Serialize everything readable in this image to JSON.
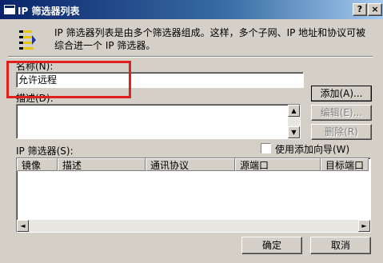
{
  "window": {
    "title": "IP 筛选器列表",
    "help_glyph": "?",
    "close_glyph": "×"
  },
  "intro": {
    "text": "IP 筛选器列表是由多个筛选器组成。这样，多个子网、IP 地址和协议可被综合进一个 IP 筛选器。"
  },
  "name": {
    "label": "名称(N):",
    "value": "允许远程"
  },
  "description": {
    "label": "描述(D):",
    "value": ""
  },
  "buttons": {
    "add": "添加(A)...",
    "edit": "编辑(E)...",
    "remove": "删除(R)",
    "ok": "确定",
    "cancel": "取消"
  },
  "wizard_checkbox": {
    "label": "使用添加向导(W)",
    "checked": false
  },
  "filters": {
    "label": "IP 筛选器(S):",
    "columns": [
      "镜像",
      "描述",
      "通讯协议",
      "源端口",
      "目标端口"
    ],
    "rows": []
  },
  "icons": {
    "scroll_up": "▲",
    "scroll_down": "▼",
    "scroll_left": "◄",
    "scroll_right": "►"
  },
  "colors": {
    "annotation": "#e0201c",
    "titlebar": "#0a246a"
  }
}
